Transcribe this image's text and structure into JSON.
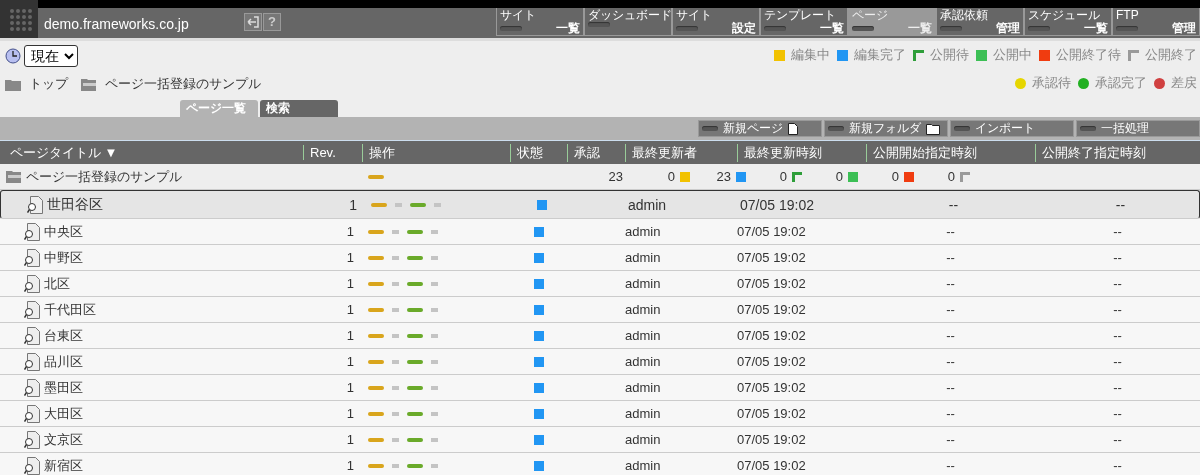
{
  "header": {
    "site": "demo.frameworks.co.jp",
    "help": "?"
  },
  "nav": [
    {
      "top": "サイト",
      "bottom": "一覧",
      "selected": false
    },
    {
      "top": "ダッシュボード",
      "selected": false
    },
    {
      "top": "サイト",
      "bottom": "設定",
      "selected": false
    },
    {
      "top": "テンプレート",
      "bottom": "一覧",
      "selected": false
    },
    {
      "top": "ページ",
      "bottom": "一覧",
      "selected": true
    },
    {
      "top": "承認依頼",
      "bottom": "管理",
      "selected": false
    },
    {
      "top": "スケジュール",
      "bottom": "一覧",
      "selected": false
    },
    {
      "top": "FTP",
      "bottom": "管理",
      "selected": false
    }
  ],
  "time_select": {
    "value": "現在"
  },
  "breadcrumb": [
    "トップ",
    "ページ一括登録のサンプル"
  ],
  "status_legend": [
    {
      "label": "編集中",
      "color": "#f2c200",
      "kind": "square"
    },
    {
      "label": "編集完了",
      "color": "#2196f3",
      "kind": "square"
    },
    {
      "label": "公開待",
      "color": "#2e9e3a",
      "kind": "corner"
    },
    {
      "label": "公開中",
      "color": "#3cbf55",
      "kind": "square"
    },
    {
      "label": "公開終了待",
      "color": "#f03c10",
      "kind": "square"
    },
    {
      "label": "公開終了",
      "color": "#9a9a9a",
      "kind": "corner"
    }
  ],
  "approval_legend": [
    {
      "label": "承認待",
      "color": "#e6d600"
    },
    {
      "label": "承認完了",
      "color": "#22b022"
    },
    {
      "label": "差戻",
      "color": "#d04040"
    }
  ],
  "tabs": [
    {
      "label": "ページ一覧",
      "selected": true
    },
    {
      "label": "検索",
      "selected": false
    }
  ],
  "toolbar": [
    {
      "label": "新規ページ",
      "kind": "page"
    },
    {
      "label": "新規フォルダ",
      "kind": "folder"
    },
    {
      "label": "インポート",
      "kind": "none"
    },
    {
      "label": "一括処理",
      "kind": "none"
    }
  ],
  "table": {
    "columns": [
      "ページタイトル ▼",
      "Rev.",
      "操作",
      "状態",
      "承認",
      "最終更新者",
      "最終更新時刻",
      "公開開始指定時刻",
      "公開終了指定時刻"
    ],
    "folder_row": {
      "title": "ページ一括登録のサンプル",
      "actions": [
        {
          "kind": "pill",
          "color": "#d9a51c"
        }
      ],
      "approval_count": "23",
      "counts": [
        {
          "value": "0",
          "color": "#f2c200",
          "kind": "square"
        },
        {
          "value": "23",
          "color": "#2196f3",
          "kind": "square"
        },
        {
          "value": "0",
          "color": "#2e9e3a",
          "kind": "corner"
        },
        {
          "value": "0",
          "color": "#3cbf55",
          "kind": "square"
        },
        {
          "value": "0",
          "color": "#f03c10",
          "kind": "square"
        },
        {
          "value": "0",
          "color": "#9a9a9a",
          "kind": "corner"
        }
      ]
    },
    "rows": [
      {
        "title": "世田谷区",
        "rev": "1",
        "color": "#2196f3",
        "updater": "admin",
        "updated": "07/05 19:02",
        "start": "--",
        "end": "--",
        "selected": true
      },
      {
        "title": "中央区",
        "rev": "1",
        "color": "#2196f3",
        "updater": "admin",
        "updated": "07/05 19:02",
        "start": "--",
        "end": "--",
        "selected": false
      },
      {
        "title": "中野区",
        "rev": "1",
        "color": "#2196f3",
        "updater": "admin",
        "updated": "07/05 19:02",
        "start": "--",
        "end": "--",
        "selected": false
      },
      {
        "title": "北区",
        "rev": "1",
        "color": "#2196f3",
        "updater": "admin",
        "updated": "07/05 19:02",
        "start": "--",
        "end": "--",
        "selected": false
      },
      {
        "title": "千代田区",
        "rev": "1",
        "color": "#2196f3",
        "updater": "admin",
        "updated": "07/05 19:02",
        "start": "--",
        "end": "--",
        "selected": false
      },
      {
        "title": "台東区",
        "rev": "1",
        "color": "#2196f3",
        "updater": "admin",
        "updated": "07/05 19:02",
        "start": "--",
        "end": "--",
        "selected": false
      },
      {
        "title": "品川区",
        "rev": "1",
        "color": "#2196f3",
        "updater": "admin",
        "updated": "07/05 19:02",
        "start": "--",
        "end": "--",
        "selected": false
      },
      {
        "title": "墨田区",
        "rev": "1",
        "color": "#2196f3",
        "updater": "admin",
        "updated": "07/05 19:02",
        "start": "--",
        "end": "--",
        "selected": false
      },
      {
        "title": "大田区",
        "rev": "1",
        "color": "#2196f3",
        "updater": "admin",
        "updated": "07/05 19:02",
        "start": "--",
        "end": "--",
        "selected": false
      },
      {
        "title": "文京区",
        "rev": "1",
        "color": "#2196f3",
        "updater": "admin",
        "updated": "07/05 19:02",
        "start": "--",
        "end": "--",
        "selected": false
      },
      {
        "title": "新宿区",
        "rev": "1",
        "color": "#2196f3",
        "updater": "admin",
        "updated": "07/05 19:02",
        "start": "--",
        "end": "--",
        "selected": false
      }
    ],
    "row_actions": [
      {
        "kind": "pill",
        "color": "#d9a51c"
      },
      {
        "kind": "stub"
      },
      {
        "kind": "pill",
        "color": "#6aaa2a"
      },
      {
        "kind": "stub"
      }
    ]
  }
}
